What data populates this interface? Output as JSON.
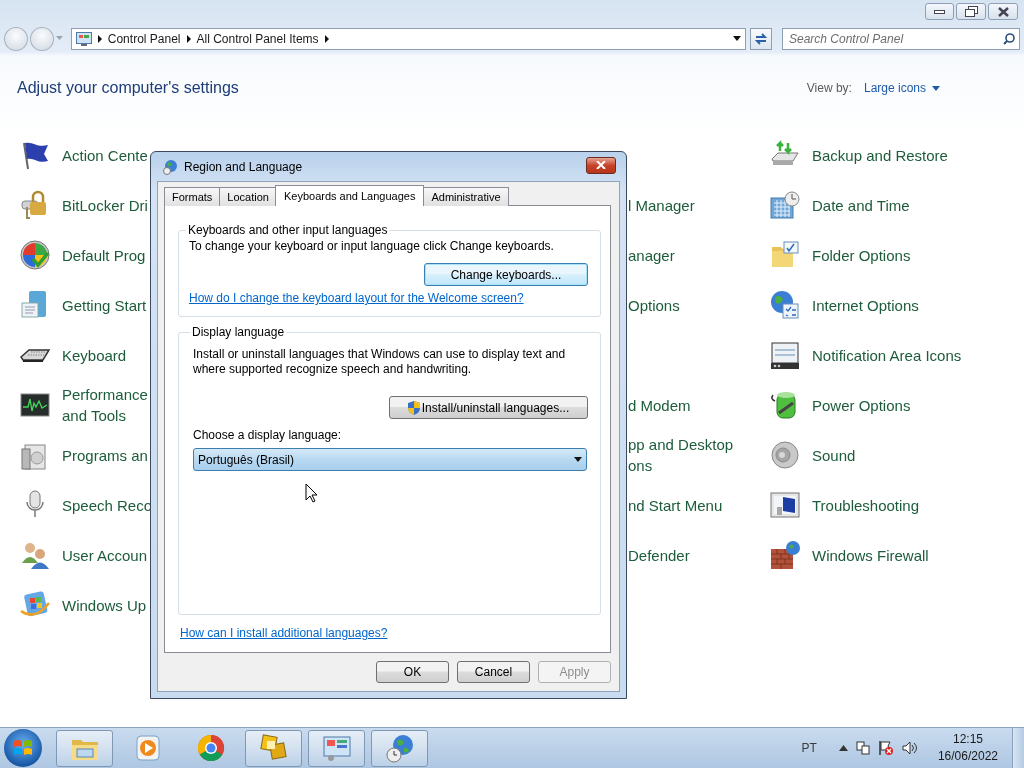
{
  "address_bar": {
    "crumbs": [
      "Control Panel",
      "All Control Panel Items"
    ]
  },
  "search": {
    "placeholder": "Search Control Panel"
  },
  "header": {
    "title": "Adjust your computer's settings",
    "view_by_label": "View by:",
    "view_by_value": "Large icons"
  },
  "items": [
    {
      "left": "Action Cente",
      "right": "Backup and Restore"
    },
    {
      "left": "BitLocker Dri",
      "middle": "l Manager",
      "right": "Date and Time"
    },
    {
      "left": "Default Prog",
      "middle": "anager",
      "right": "Folder Options"
    },
    {
      "left": "Getting Start",
      "middle": "Options",
      "right": "Internet Options"
    },
    {
      "left": "Keyboard",
      "right": "Notification Area Icons"
    },
    {
      "left": "Performance\nand Tools",
      "middle": "d Modem",
      "right": "Power Options"
    },
    {
      "left": "Programs an",
      "middle": "pp and Desktop\nons",
      "right": "Sound"
    },
    {
      "left": "Speech Reco",
      "middle": "nd Start Menu",
      "right": "Troubleshooting"
    },
    {
      "left": "User Accoun",
      "middle": "Defender",
      "right": "Windows Firewall"
    },
    {
      "left": "Windows Up"
    }
  ],
  "dialog": {
    "title": "Region and Language",
    "tabs": [
      {
        "label": "Formats",
        "selected": false
      },
      {
        "label": "Location",
        "selected": false
      },
      {
        "label": "Keyboards and Languages",
        "selected": true
      },
      {
        "label": "Administrative",
        "selected": false
      }
    ],
    "keyboards_group": {
      "legend": "Keyboards and other input languages",
      "text": "To change your keyboard or input language click Change keyboards.",
      "button": {
        "label": "Change keyboards...",
        "focused": true
      },
      "link": "How do I change the keyboard layout for the Welcome screen?"
    },
    "display_group": {
      "legend": "Display language",
      "text": "Install or uninstall languages that Windows can use to display text and where supported recognize speech and handwriting.",
      "button": {
        "label": "Install/uninstall languages...",
        "focused": false
      },
      "choose_label": "Choose a display language:",
      "language": "Português (Brasil)"
    },
    "link": "How can I install additional languages?",
    "buttons": [
      {
        "label": "OK",
        "disabled": false
      },
      {
        "label": "Cancel",
        "disabled": false
      },
      {
        "label": "Apply",
        "disabled": true
      }
    ]
  },
  "taskbar": {
    "apps": [
      {
        "running": true
      },
      {
        "running": false
      },
      {
        "running": false
      },
      {
        "running": true
      },
      {
        "running": true
      },
      {
        "running": true
      }
    ],
    "language": "PT",
    "time": "12:15",
    "date": "16/06/2022"
  }
}
